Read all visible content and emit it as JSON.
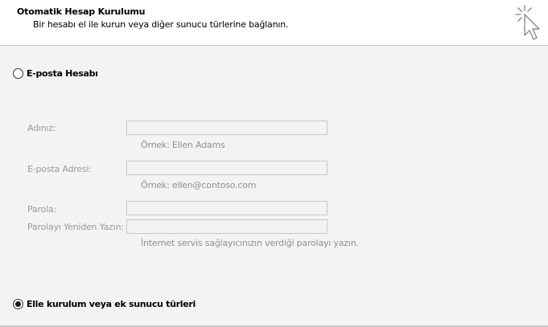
{
  "header": {
    "title": "Otomatik Hesap Kurulumu",
    "subtitle": "Bir hesabı el ile kurun veya diğer sunucu türlerine bağlanın.",
    "icon": "wizard-cursor-icon"
  },
  "options": {
    "email_account": {
      "label": "E-posta Hesabı",
      "selected": false
    },
    "manual_setup": {
      "label": "Elle kurulum veya ek sunucu türleri",
      "selected": true
    }
  },
  "form": {
    "name": {
      "label": "Adınız:",
      "value": "",
      "hint": "Örnek: Ellen Adams"
    },
    "email": {
      "label": "E-posta Adresi:",
      "value": "",
      "hint": "Örnek: ellen@contoso.com"
    },
    "password": {
      "label": "Parola:",
      "value": ""
    },
    "password_confirm": {
      "label": "Parolayı Yeniden Yazın:",
      "value": "",
      "hint": "İnternet servis sağlayıcınızın verdiği parolayı yazın."
    }
  },
  "colors": {
    "background": "#f3f3f3",
    "header_background": "#ffffff",
    "disabled_text": "#9a9a9a",
    "input_border": "#c8c8c8"
  }
}
